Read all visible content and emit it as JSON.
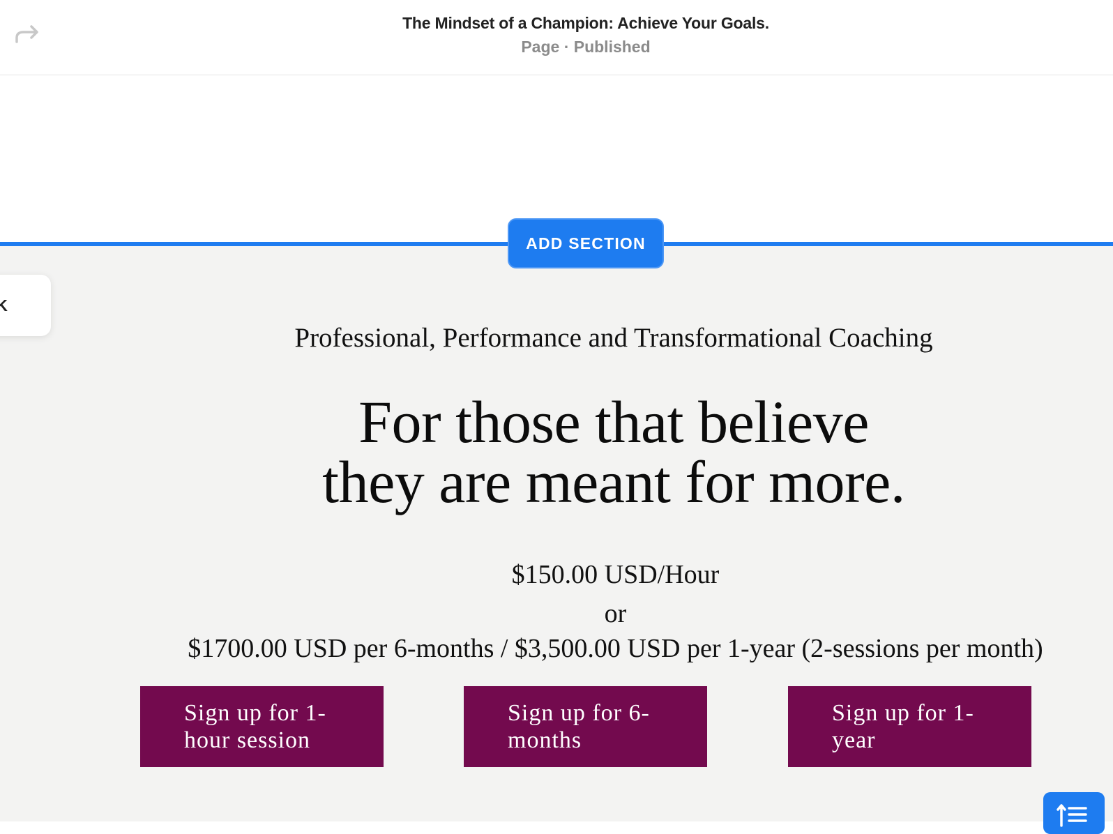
{
  "header": {
    "title": "The Mindset of a Champion: Achieve Your Goals.",
    "subtitle": "Page · Published"
  },
  "icons": {
    "redo": "redo-arrow-icon",
    "layout": "layout-lines-icon"
  },
  "editor": {
    "add_section_label": "ADD SECTION",
    "back_label": "CK",
    "accent_color": "#1e7cf0"
  },
  "content": {
    "eyebrow": "Professional, Performance and Transformational Coaching",
    "headline_line1": "For those that believe",
    "headline_line2": "they are meant for more.",
    "price_hour": "$150.00 USD/Hour",
    "price_or": "or",
    "price_term": "$1700.00 USD per 6-months / $3,500.00 USD per 1-year (2-sessions per month)",
    "background_color": "#f3f3f2"
  },
  "buttons": [
    {
      "label": "Sign up for 1-hour session",
      "line1": "Sign up for 1-",
      "line2": "hour session"
    },
    {
      "label": "Sign up for 6-months",
      "line1": "Sign up for 6-",
      "line2": "months"
    },
    {
      "label": "Sign up for 1-year",
      "line1": "Sign up for 1-",
      "line2": "year"
    }
  ],
  "button_color": "#730a4e"
}
